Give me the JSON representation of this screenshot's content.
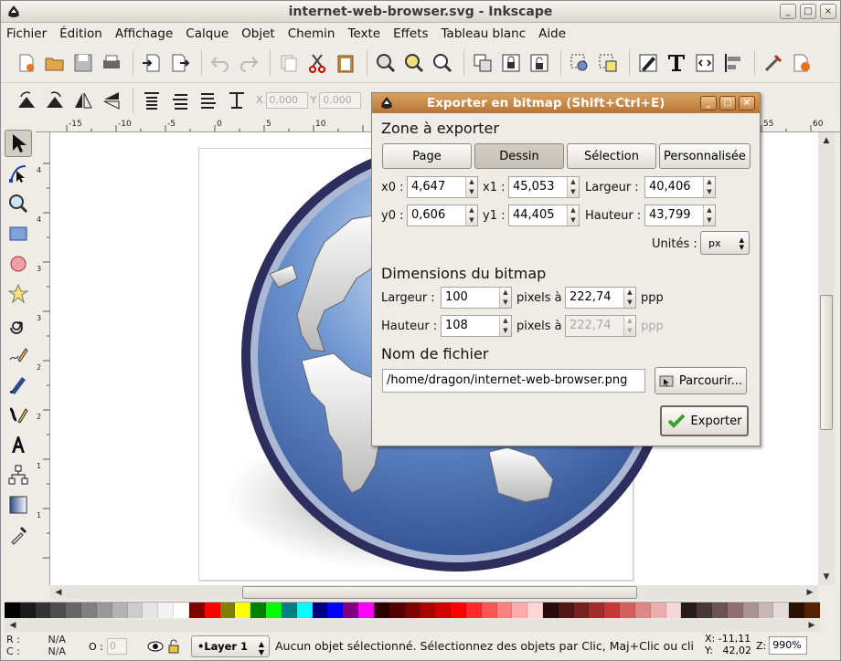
{
  "window": {
    "title": "internet-web-browser.svg - Inkscape",
    "controls": [
      "_",
      "□",
      "×"
    ]
  },
  "menu": [
    "Fichier",
    "Édition",
    "Affichage",
    "Calque",
    "Objet",
    "Chemin",
    "Texte",
    "Effets",
    "Tableau blanc",
    "Aide"
  ],
  "toolbar2": {
    "x_label": "X",
    "x_value": "0,000",
    "y_label": "Y",
    "y_value": "0,000"
  },
  "status": {
    "r_label": "R :",
    "r_value": "N/A",
    "c_label": "C :",
    "c_value": "N/A",
    "o_label": "O :",
    "o_value": "0",
    "layer": "•Layer 1",
    "message": "Aucun objet sélectionné. Sélectionnez des objets par Clic, Maj+Clic ou cli",
    "cursor_x_label": "X:",
    "cursor_x": "-11,11",
    "cursor_y_label": "Y:",
    "cursor_y": "42,02",
    "zoom_label": "Z:",
    "zoom": "990%"
  },
  "palette": [
    "#000000",
    "#1a1a1a",
    "#333333",
    "#4d4d4d",
    "#666666",
    "#808080",
    "#999999",
    "#b3b3b3",
    "#cccccc",
    "#e6e6e6",
    "#f2f2f2",
    "#ffffff",
    "#800000",
    "#ff0000",
    "#808000",
    "#ffff00",
    "#008000",
    "#00ff00",
    "#008080",
    "#00ffff",
    "#000080",
    "#0000ff",
    "#800080",
    "#ff00ff",
    "#2b0000",
    "#550000",
    "#800000",
    "#aa0000",
    "#d40000",
    "#ff0000",
    "#ff2a2a",
    "#ff5555",
    "#ff8080",
    "#ffaaaa",
    "#ffd5d5",
    "#280b0b",
    "#501616",
    "#782121",
    "#a02c2c",
    "#c83737",
    "#d35f5f",
    "#de8787",
    "#e9afaf",
    "#f4d7d7",
    "#241c1c",
    "#483737",
    "#6c5353",
    "#916f6f",
    "#ac9393",
    "#c8b7b7",
    "#e3dbdb",
    "#2b1100",
    "#552200"
  ],
  "dialog": {
    "title": "Exporter en bitmap (Shift+Ctrl+E)",
    "area_heading": "Zone à exporter",
    "area_buttons": [
      "Page",
      "Dessin",
      "Sélection",
      "Personnalisée"
    ],
    "x0_label": "x0 :",
    "x0": "4,647",
    "x1_label": "x1 :",
    "x1": "45,053",
    "width_label": "Largeur :",
    "width": "40,406",
    "y0_label": "y0 :",
    "y0": "0,606",
    "y1_label": "y1 :",
    "y1": "44,405",
    "height_label": "Hauteur :",
    "height": "43,799",
    "units_label": "Unités :",
    "units": "px",
    "bitmap_heading": "Dimensions du bitmap",
    "bm_width_label": "Largeur :",
    "bm_width": "100",
    "pixels_at": "pixels à",
    "dpi_x": "222,74",
    "ppp": "ppp",
    "bm_height_label": "Hauteur :",
    "bm_height": "108",
    "dpi_y": "222,74",
    "file_heading": "Nom de fichier",
    "filename": "/home/dragon/internet-web-browser.png",
    "browse": "Parcourir...",
    "export": "Exporter"
  }
}
